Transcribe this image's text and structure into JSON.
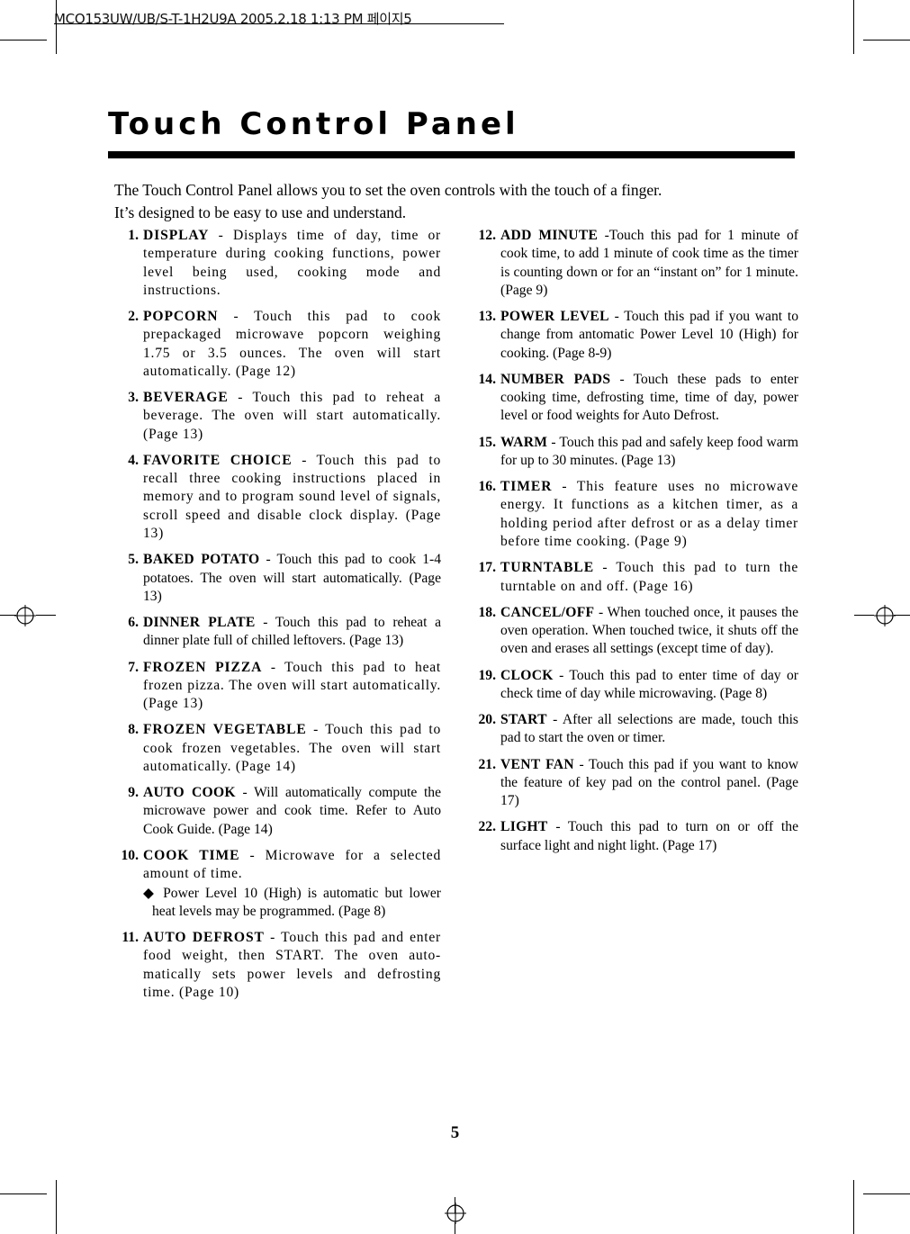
{
  "print_banner": {
    "text": "MCO153UW/UB/S-T-1H2U9A 2005.2.18 1:13 PM 페이지5"
  },
  "page": {
    "title": "Touch Control Panel",
    "intro_line1": "The Touch Control Panel allows you to set the oven controls with the touch of a finger.",
    "intro_line2": "It’s designed to be easy to use and understand.",
    "page_number": "5"
  },
  "items_left": [
    {
      "num": "1.",
      "term": "DISPLAY",
      "text": " - Displays time of day, time or temperature during cooking functions, power level being used, cooking mode and instructions."
    },
    {
      "num": "2.",
      "term": "POPCORN",
      "text": " - Touch this pad to cook prepackaged microwave popcorn weighing 1.75 or 3.5 ounces. The oven will start automatically. (Page 12)"
    },
    {
      "num": "3.",
      "term": "BEVERAGE",
      "text": " - Touch this pad to reheat a beverage. The oven will start automatically. (Page 13)"
    },
    {
      "num": "4.",
      "term": "FAVORITE CHOICE",
      "text": " - Touch this pad to recall three cooking instructions placed in memory and to program sound level of signals, scroll speed and disable clock display. (Page 13)"
    },
    {
      "num": "5.",
      "term": "BAKED POTATO",
      "text": " - Touch this pad to cook 1-4 potatoes. The oven will start automatically. (Page 13)"
    },
    {
      "num": "6.",
      "term": "DINNER PLATE",
      "text": " - Touch this pad to reheat a dinner plate full of chilled leftovers. (Page 13)"
    },
    {
      "num": "7.",
      "term": "FROZEN PIZZA",
      "text": " - Touch this pad to heat frozen pizza. The oven will start automatically. (Page 13)"
    },
    {
      "num": "8.",
      "term": "FROZEN VEGETABLE",
      "text": " - Touch this pad to cook frozen vegetables. The oven will start automatically. (Page 14)"
    },
    {
      "num": "9.",
      "term": "AUTO COOK",
      "text": " - Will automatically compute the microwave power and cook time. Refer to Auto Cook Guide. (Page 14)"
    },
    {
      "num": "10.",
      "term": "COOK TIME",
      "text": " - Microwave for a selected amount of time.",
      "sub": "◆ Power Level 10 (High) is automatic but lower heat levels may be programmed. (Page 8)"
    },
    {
      "num": "11.",
      "term": "AUTO DEFROST",
      "text": " - Touch this pad and enter food weight, then START. The oven auto-matically sets power levels and defrosting time. (Page 10)"
    }
  ],
  "items_right": [
    {
      "num": "12.",
      "term": "ADD MINUTE",
      "text": " -Touch this pad for 1 minute of cook time, to add 1 minute of cook time as the timer is counting down or for an “instant on” for 1 minute. (Page 9)"
    },
    {
      "num": "13.",
      "term": "POWER LEVEL",
      "text": " - Touch this pad if you want to change from antomatic Power Level 10 (High) for cooking. (Page 8-9)"
    },
    {
      "num": "14.",
      "term": "NUMBER PADS",
      "text": " - Touch these pads to enter cooking time, defrosting time, time of day, power level or food weights for Auto Defrost."
    },
    {
      "num": "15.",
      "term": "WARM",
      "text": " - Touch this pad and safely keep food warm for up to 30 minutes. (Page 13)"
    },
    {
      "num": "16.",
      "term": "TIMER",
      "text": " - This feature uses no microwave energy. It functions as a kitchen timer, as a holding period after defrost or as a delay timer before time cooking. (Page 9)"
    },
    {
      "num": "17.",
      "term": "TURNTABLE",
      "text": " - Touch this pad to turn the turntable on and off. (Page 16)"
    },
    {
      "num": "18.",
      "term": "CANCEL/OFF",
      "text": " - When touched once, it pauses the oven operation. When touched twice, it shuts off the oven and erases all settings (except time of day)."
    },
    {
      "num": "19.",
      "term": "CLOCK",
      "text": " - Touch this pad to enter time of day or check time of day while microwaving. (Page 8)"
    },
    {
      "num": "20.",
      "term": "START",
      "text": " - After all selections are made, touch this pad to start the oven or timer."
    },
    {
      "num": "21.",
      "term": "VENT FAN",
      "text": " - Touch this pad if you want to know the feature of key pad on the control panel. (Page 17)"
    },
    {
      "num": "22.",
      "term": "LIGHT",
      "text": " - Touch this pad to turn on or off the surface light and night light. (Page 17)"
    }
  ]
}
